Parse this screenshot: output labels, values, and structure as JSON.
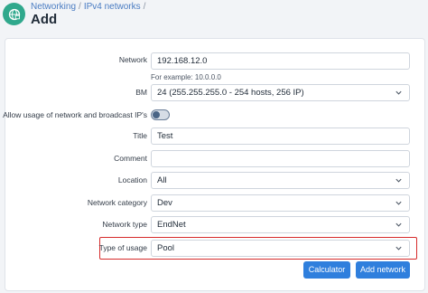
{
  "header": {
    "app_icon": "network-globe-icon",
    "breadcrumb": [
      "Networking",
      "IPv4 networks"
    ],
    "breadcrumb_separator": "/",
    "title": "Add"
  },
  "form": {
    "network": {
      "label": "Network",
      "value": "192.168.12.0",
      "hint": "For example: 10.0.0.0"
    },
    "bm": {
      "label": "BM",
      "value": "24 (255.255.255.0 - 254 hosts, 256 IP)"
    },
    "allow_usage": {
      "label": "Allow usage of network and broadcast IP's",
      "enabled": false
    },
    "title": {
      "label": "Title",
      "value": "Test"
    },
    "comment": {
      "label": "Comment",
      "value": ""
    },
    "location": {
      "label": "Location",
      "value": "All"
    },
    "network_category": {
      "label": "Network category",
      "value": "Dev"
    },
    "network_type": {
      "label": "Network type",
      "value": "EndNet"
    },
    "type_of_usage": {
      "label": "Type of usage",
      "value": "Pool"
    }
  },
  "buttons": {
    "calculator": "Calculator",
    "add_network": "Add network"
  },
  "colors": {
    "accent": "#2f7fdd",
    "brand": "#2fa88c",
    "highlight": "#d62b2b"
  }
}
